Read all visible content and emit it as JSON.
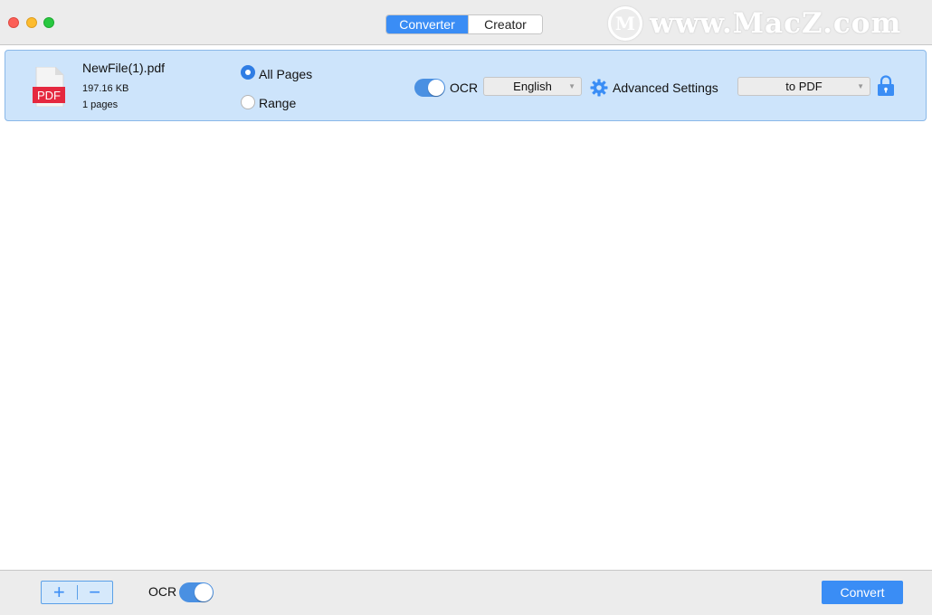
{
  "titlebar": {
    "tabs": [
      {
        "label": "Converter",
        "active": true
      },
      {
        "label": "Creator",
        "active": false
      }
    ],
    "watermark": {
      "logo_letter": "M",
      "text": "www.MacZ.com"
    }
  },
  "file": {
    "icon_label": "PDF",
    "name": "NewFile(1).pdf",
    "size": "197.16 KB",
    "pages": "1 pages",
    "page_options": [
      {
        "label": "All Pages",
        "selected": true
      },
      {
        "label": "Range",
        "selected": false
      }
    ],
    "ocr": {
      "label": "OCR",
      "enabled": true
    },
    "language": "English",
    "advanced_settings_label": "Advanced Settings",
    "output_format": "to PDF",
    "icons": {
      "file": "pdf-file-icon",
      "settings": "gear-icon",
      "lock": "lock-icon"
    }
  },
  "bottom": {
    "add_label": "+",
    "remove_label": "−",
    "ocr_label": "OCR",
    "ocr_enabled": true,
    "convert_label": "Convert"
  },
  "colors": {
    "accent": "#3a8df5",
    "row_background": "#cde4fb",
    "pdf_red": "#e5283f"
  }
}
